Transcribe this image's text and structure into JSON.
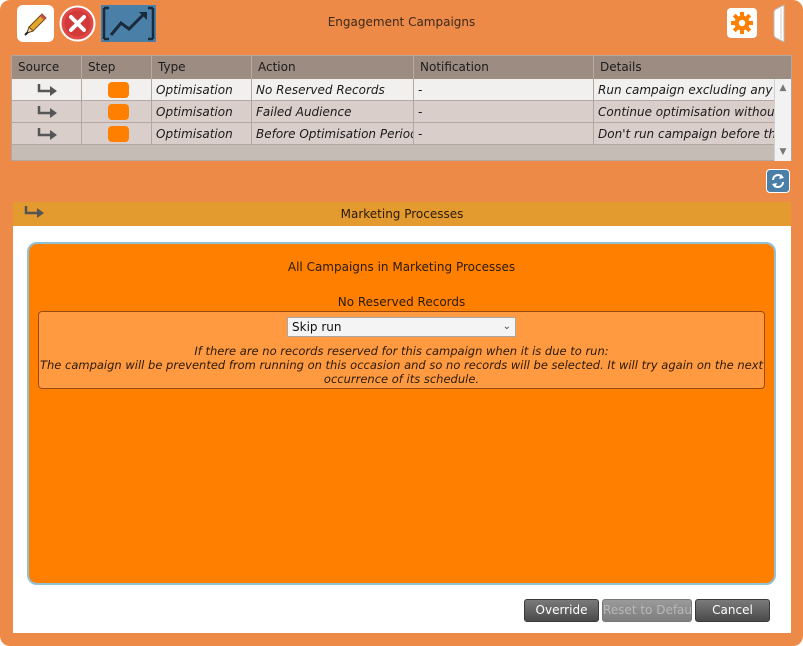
{
  "header": {
    "title": "Engagement Campaigns"
  },
  "grid": {
    "columns": [
      "Source",
      "Step",
      "Type",
      "Action",
      "Notification",
      "Details"
    ],
    "rows": [
      {
        "type": "Optimisation",
        "action": "No Reserved Records",
        "notification": "-",
        "details": "Run campaign excluding any reco"
      },
      {
        "type": "Optimisation",
        "action": "Failed Audience",
        "notification": "-",
        "details": "Continue optimisation without a c"
      },
      {
        "type": "Optimisation",
        "action": "Before Optimisation Period",
        "notification": "-",
        "details": "Don't run campaign before the fir"
      }
    ]
  },
  "panel": {
    "title": "Marketing Processes",
    "campaign_title": "All Campaigns in Marketing Processes",
    "setting_label": "No Reserved Records",
    "select_value": "Skip run",
    "description_line1": "If there are no records reserved for this campaign when it is due to run:",
    "description_line2": "The campaign will be prevented from running on this occasion and so no records will be selected.  It will try again on the next",
    "description_line3": "occurrence of its schedule."
  },
  "buttons": {
    "override": "Override",
    "reset": "Reset to Default",
    "cancel": "Cancel"
  },
  "colors": {
    "window_bg": "#ee8a47",
    "accent_orange": "#ff8000",
    "panel_header": "#e39a2e",
    "icon_blue": "#4a7fa8"
  }
}
